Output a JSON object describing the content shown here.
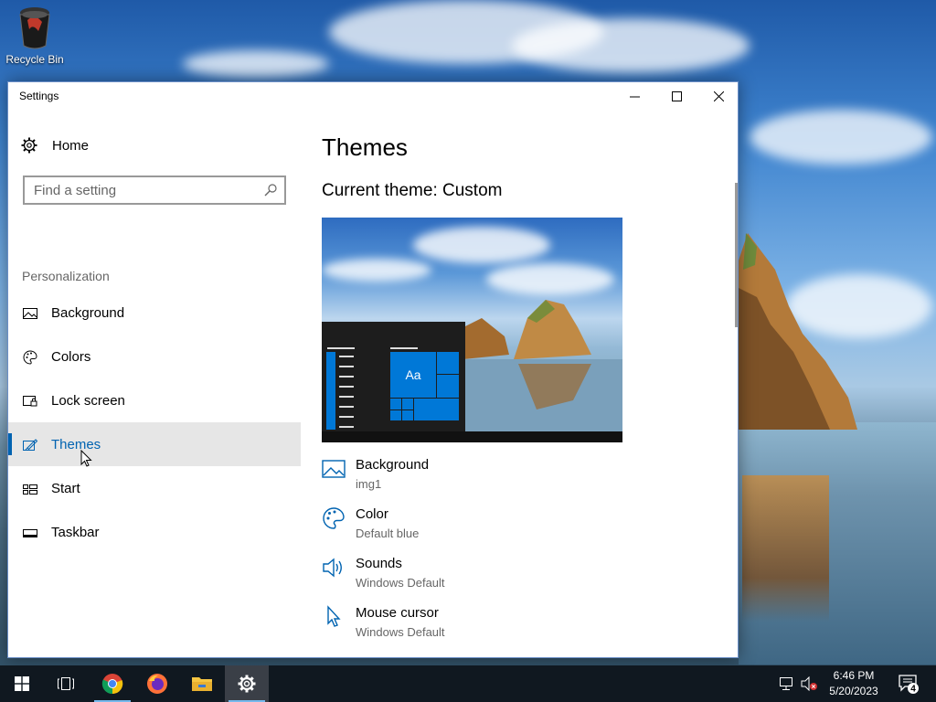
{
  "desktop": {
    "icons": [
      {
        "label": "Recycle Bin",
        "icon": "recycle-bin-icon"
      }
    ]
  },
  "window": {
    "title": "Settings",
    "controls": {
      "minimize": "minimize-icon",
      "maximize": "maximize-icon",
      "close": "close-icon"
    }
  },
  "sidebar": {
    "home_label": "Home",
    "search_placeholder": "Find a setting",
    "section_label": "Personalization",
    "items": [
      {
        "label": "Background",
        "icon": "image-icon",
        "active": false
      },
      {
        "label": "Colors",
        "icon": "palette-icon",
        "active": false
      },
      {
        "label": "Lock screen",
        "icon": "lock-screen-icon",
        "active": false
      },
      {
        "label": "Themes",
        "icon": "themes-icon",
        "active": true
      },
      {
        "label": "Start",
        "icon": "start-icon",
        "active": false
      },
      {
        "label": "Taskbar",
        "icon": "taskbar-icon",
        "active": false
      }
    ]
  },
  "main": {
    "title": "Themes",
    "current_theme": "Current theme: Custom",
    "preview_tile_text": "Aa",
    "properties": [
      {
        "label": "Background",
        "value": "img1",
        "icon": "image-icon"
      },
      {
        "label": "Color",
        "value": "Default blue",
        "icon": "palette-icon"
      },
      {
        "label": "Sounds",
        "value": "Windows Default",
        "icon": "speaker-icon"
      },
      {
        "label": "Mouse cursor",
        "value": "Windows Default",
        "icon": "cursor-icon"
      }
    ]
  },
  "taskbar": {
    "apps": [
      {
        "name": "start-button",
        "icon": "windows-icon"
      },
      {
        "name": "task-view-button",
        "icon": "task-view-icon"
      },
      {
        "name": "chrome-button",
        "icon": "chrome-icon"
      },
      {
        "name": "firefox-button",
        "icon": "firefox-icon"
      },
      {
        "name": "file-explorer-button",
        "icon": "folder-icon"
      },
      {
        "name": "settings-button",
        "icon": "gear-icon",
        "active": true
      }
    ],
    "clock": {
      "time": "6:46 PM",
      "date": "5/20/2023"
    },
    "notification_count": "4"
  },
  "colors": {
    "accent": "#0078d7",
    "active_text": "#0063b1",
    "taskbar": "#101820"
  }
}
